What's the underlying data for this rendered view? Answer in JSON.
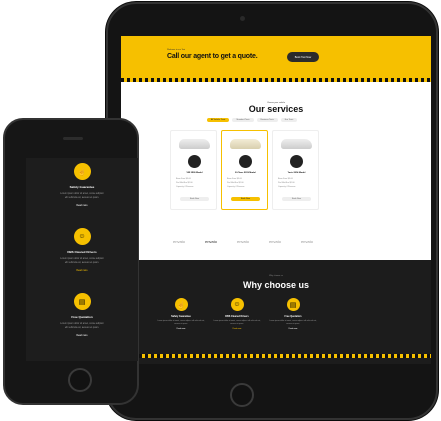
{
  "banner": {
    "eyebrow": "Welcome to our Taxi",
    "title": "Call our agent to get a quote.",
    "button": "Book Taxi Now"
  },
  "services": {
    "eyebrow": "Choose your vehicle",
    "title": "Our services",
    "tabs": [
      "All Vehicle Taxis",
      "Standard Taxis",
      "Business Taxis",
      "Eco Taxis"
    ],
    "cards": [
      {
        "name": "VW 2500 Model",
        "rows": [
          [
            "Base Fare",
            "$5.00"
          ],
          [
            "Per Mile/Km",
            "$2.00"
          ],
          [
            "Capacity",
            "4 Persons"
          ]
        ],
        "button": "Book Now"
      },
      {
        "name": "E-Class 2019 Model",
        "rows": [
          [
            "Base Fare",
            "$5.00"
          ],
          [
            "Per Mile/Km",
            "$2.00"
          ],
          [
            "Capacity",
            "4 Persons"
          ]
        ],
        "button": "Book Now"
      },
      {
        "name": "Yaris 2014 Model",
        "rows": [
          [
            "Base Fare",
            "$5.00"
          ],
          [
            "Per Mile/Km",
            "$2.00"
          ],
          [
            "Capacity",
            "4 Persons"
          ]
        ],
        "button": "Book Now"
      }
    ]
  },
  "partners": [
    "envato",
    "envato",
    "envato",
    "envato",
    "envato"
  ],
  "why": {
    "eyebrow": "Why choose us",
    "title": "Why choose us",
    "items": [
      {
        "title": "Safety Guarantee",
        "text": "Lorem ipsum dolor sit amet, conse adipisci elit vehicula est, aenean et quam.",
        "link": "Read more"
      },
      {
        "title": "DBS Cleared Drivers",
        "text": "Lorem ipsum dolor sit amet, conse adipisci elit vehicula est, aenean et quam.",
        "link": "Read more"
      },
      {
        "title": "Free Quotation",
        "text": "Lorem ipsum dolor sit amet, conse adipisci elit vehicula est, aenean et quam.",
        "link": "Read more"
      }
    ]
  },
  "colors": {
    "accent": "#f6c000",
    "dark": "#1c1c1c"
  }
}
